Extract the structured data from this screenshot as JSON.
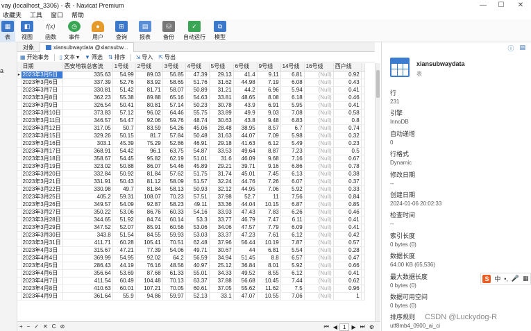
{
  "window": {
    "title": "vay (localhost_3306) - 表 - Navicat Premium",
    "minimize": "—",
    "maximize": "☐",
    "close": "✕"
  },
  "menu": [
    "收藏夹",
    "工具",
    "窗口",
    "帮助"
  ],
  "toolbar": {
    "items": [
      {
        "label": "表",
        "icon": "table-icon",
        "color": "#3b78c9"
      },
      {
        "label": "视图",
        "icon": "view-icon",
        "color": "#3b78c9"
      },
      {
        "label": "函数",
        "icon": "function-icon",
        "color": "#666666"
      },
      {
        "label": "事件",
        "icon": "event-icon",
        "color": "#3aa655"
      },
      {
        "label": "用户",
        "icon": "user-icon",
        "color": "#e69a2a"
      },
      {
        "label": "查询",
        "icon": "query-icon",
        "color": "#3b78c9"
      },
      {
        "label": "报表",
        "icon": "report-icon",
        "color": "#3b78c9"
      },
      {
        "label": "备份",
        "icon": "backup-icon",
        "color": "#666666"
      },
      {
        "label": "自动运行",
        "icon": "automation-icon",
        "color": "#3aa655"
      },
      {
        "label": "模型",
        "icon": "model-icon",
        "color": "#3b78c9"
      }
    ]
  },
  "left": {
    "letter": "a"
  },
  "tabs": {
    "object": "对象",
    "active": "xiansubwaydata @xiansubw..."
  },
  "datatoolbar": {
    "begin_transaction": "开始事务",
    "text": "文本",
    "filter": "筛选",
    "sort": "排序",
    "import": "导入",
    "export": "导出"
  },
  "grid": {
    "columns": [
      "日期",
      "西安地铁总客流",
      "1号线",
      "2号线",
      "3号线",
      "4号线",
      "5号线",
      "6号线",
      "9号线",
      "14号线",
      "16号线",
      "西户线"
    ],
    "null_text": "(Null)",
    "rows": [
      [
        "2023年3月5日",
        "335.63",
        "54.99",
        "89.03",
        "56.85",
        "47.39",
        "29.13",
        "41.4",
        "9.11",
        "6.81",
        "(Null)",
        "0.92"
      ],
      [
        "2023年3月6日",
        "337.39",
        "52.76",
        "83.92",
        "58.65",
        "51.76",
        "31.62",
        "44.98",
        "7.19",
        "6.08",
        "(Null)",
        "0.43"
      ],
      [
        "2023年3月7日",
        "330.81",
        "51.42",
        "81.71",
        "58.07",
        "50.89",
        "31.21",
        "44.2",
        "6.96",
        "5.94",
        "(Null)",
        "0.41"
      ],
      [
        "2023年3月8日",
        "362.23",
        "55.38",
        "89.88",
        "65.16",
        "54.63",
        "33.81",
        "48.65",
        "8.08",
        "6.18",
        "(Null)",
        "0.46"
      ],
      [
        "2023年3月9日",
        "326.54",
        "50.41",
        "80.81",
        "57.14",
        "50.23",
        "30.78",
        "43.9",
        "6.91",
        "5.95",
        "(Null)",
        "0.41"
      ],
      [
        "2023年3月10日",
        "373.83",
        "57.12",
        "96.02",
        "64.46",
        "55.75",
        "33.89",
        "49.9",
        "9.03",
        "7.08",
        "(Null)",
        "0.58"
      ],
      [
        "2023年3月11日",
        "346.57",
        "54.47",
        "92.06",
        "59.76",
        "48.74",
        "30.63",
        "43.8",
        "9.48",
        "6.83",
        "(Null)",
        "0.8"
      ],
      [
        "2023年3月12日",
        "317.05",
        "50.7",
        "83.59",
        "54.26",
        "45.06",
        "28.48",
        "38.95",
        "8.57",
        "6.7",
        "(Null)",
        "0.74"
      ],
      [
        "2023年3月15日",
        "329.26",
        "50.15",
        "81.7",
        "57.84",
        "50.48",
        "31.63",
        "44.07",
        "7.09",
        "5.98",
        "(Null)",
        "0.32"
      ],
      [
        "2023年3月16日",
        "303.1",
        "45.39",
        "75.29",
        "52.86",
        "46.91",
        "29.18",
        "41.63",
        "6.12",
        "5.49",
        "(Null)",
        "0.23"
      ],
      [
        "2023年3月17日",
        "368.91",
        "54.42",
        "96.1",
        "63.75",
        "54.87",
        "33.53",
        "49.64",
        "8.87",
        "7.23",
        "(Null)",
        "0.5"
      ],
      [
        "2023年3月18日",
        "358.67",
        "54.45",
        "95.82",
        "62.19",
        "51.01",
        "31.6",
        "46.09",
        "9.68",
        "7.16",
        "(Null)",
        "0.67"
      ],
      [
        "2023年3月19日",
        "323.02",
        "50.88",
        "86.07",
        "54.46",
        "45.89",
        "29.21",
        "39.71",
        "9.16",
        "6.86",
        "(Null)",
        "0.78"
      ],
      [
        "2023年3月20日",
        "332.84",
        "50.92",
        "81.84",
        "57.62",
        "51.75",
        "31.74",
        "45.01",
        "7.45",
        "6.13",
        "(Null)",
        "0.38"
      ],
      [
        "2023年3月21日",
        "331.91",
        "50.43",
        "81.12",
        "58.09",
        "51.57",
        "32.24",
        "44.76",
        "7.26",
        "6.07",
        "(Null)",
        "0.37"
      ],
      [
        "2023年3月22日",
        "330.98",
        "49.7",
        "81.84",
        "58.13",
        "50.93",
        "32.12",
        "44.95",
        "7.06",
        "5.92",
        "(Null)",
        "0.33"
      ],
      [
        "2023年3月25日",
        "405.2",
        "59.31",
        "108.07",
        "70.23",
        "57.51",
        "37.98",
        "52.7",
        "11",
        "7.56",
        "(Null)",
        "0.84"
      ],
      [
        "2023年3月26日",
        "349.57",
        "54.09",
        "92.87",
        "58.23",
        "49.11",
        "33.36",
        "44.04",
        "10.15",
        "6.87",
        "(Null)",
        "0.85"
      ],
      [
        "2023年3月27日",
        "350.22",
        "53.06",
        "86.76",
        "60.33",
        "54.16",
        "33.93",
        "47.43",
        "7.83",
        "6.26",
        "(Null)",
        "0.46"
      ],
      [
        "2023年3月28日",
        "344.65",
        "51.92",
        "84.74",
        "60.14",
        "53.3",
        "33.77",
        "46.79",
        "7.47",
        "6.11",
        "(Null)",
        "0.41"
      ],
      [
        "2023年3月29日",
        "347.52",
        "52.07",
        "85.91",
        "60.56",
        "53.06",
        "34.06",
        "47.57",
        "7.79",
        "6.09",
        "(Null)",
        "0.41"
      ],
      [
        "2023年3月30日",
        "343.8",
        "51.54",
        "84.55",
        "59.93",
        "53.03",
        "33.37",
        "47.23",
        "7.61",
        "6.12",
        "(Null)",
        "0.42"
      ],
      [
        "2023年3月31日",
        "411.71",
        "60.28",
        "105.41",
        "70.51",
        "62.48",
        "37.96",
        "56.44",
        "10.19",
        "7.87",
        "(Null)",
        "0.57"
      ],
      [
        "2023年4月3日",
        "315.67",
        "47.21",
        "77.39",
        "54.06",
        "49.71",
        "30.67",
        "44",
        "6.81",
        "5.54",
        "(Null)",
        "0.28"
      ],
      [
        "2023年4月4日",
        "369.99",
        "54.95",
        "92.02",
        "64.2",
        "56.59",
        "34.94",
        "51.45",
        "8.8",
        "6.57",
        "(Null)",
        "0.47"
      ],
      [
        "2023年4月5日",
        "286.43",
        "44.19",
        "76.16",
        "48.56",
        "40.97",
        "25.12",
        "36.84",
        "8.01",
        "5.92",
        "(Null)",
        "0.66"
      ],
      [
        "2023年4月6日",
        "356.64",
        "53.69",
        "87.68",
        "61.33",
        "55.01",
        "34.33",
        "49.52",
        "8.55",
        "6.12",
        "(Null)",
        "0.41"
      ],
      [
        "2023年4月7日",
        "411.54",
        "60.49",
        "104.48",
        "70.13",
        "63.37",
        "37.88",
        "56.68",
        "10.45",
        "7.44",
        "(Null)",
        "0.62"
      ],
      [
        "2023年4月8日",
        "410.63",
        "60.01",
        "107.21",
        "70.05",
        "60.61",
        "37.05",
        "55.62",
        "11.62",
        "7.5",
        "(Null)",
        "0.96"
      ],
      [
        "2023年4月9日",
        "361.64",
        "55.9",
        "94.86",
        "59.97",
        "52.13",
        "33.1",
        "47.07",
        "10.55",
        "7.06",
        "(Null)",
        "1"
      ]
    ]
  },
  "statusbar": {
    "add": "+",
    "remove": "−",
    "check": "✓",
    "cancel": "✕",
    "refresh": "C",
    "stop": "⊘",
    "first": "⏮",
    "prev": "◀",
    "page": "1",
    "next": "▶",
    "last": "⏭",
    "settings": "⚙"
  },
  "info": {
    "info_icon": "ⓘ",
    "ddl_icon": "▤",
    "table_name": "xiansubwaydata",
    "table_type": "表",
    "props": [
      {
        "key": "行",
        "value": "231"
      },
      {
        "key": "引擎",
        "value": "InnoDB"
      },
      {
        "key": "自动递增",
        "value": "0"
      },
      {
        "key": "行格式",
        "value": "Dynamic"
      },
      {
        "key": "修改日期",
        "value": "--"
      },
      {
        "key": "创建日期",
        "value": "2024-01-06 20:02:33"
      },
      {
        "key": "检查时间",
        "value": "--"
      },
      {
        "key": "索引长度",
        "value": "0 bytes (0)"
      },
      {
        "key": "数据长度",
        "value": "64.00 KB (65,536)"
      },
      {
        "key": "最大数据长度",
        "value": "0 bytes (0)"
      },
      {
        "key": "数据可用空间",
        "value": "0 bytes (0)"
      },
      {
        "key": "排序规则",
        "value": "utf8mb4_0900_ai_ci"
      }
    ]
  },
  "ime": {
    "logo": "S",
    "lang": "中",
    "dot": "•,",
    "mic": "🎤",
    "menu": "▦"
  },
  "watermark": "CSDN @Luckydog-R"
}
